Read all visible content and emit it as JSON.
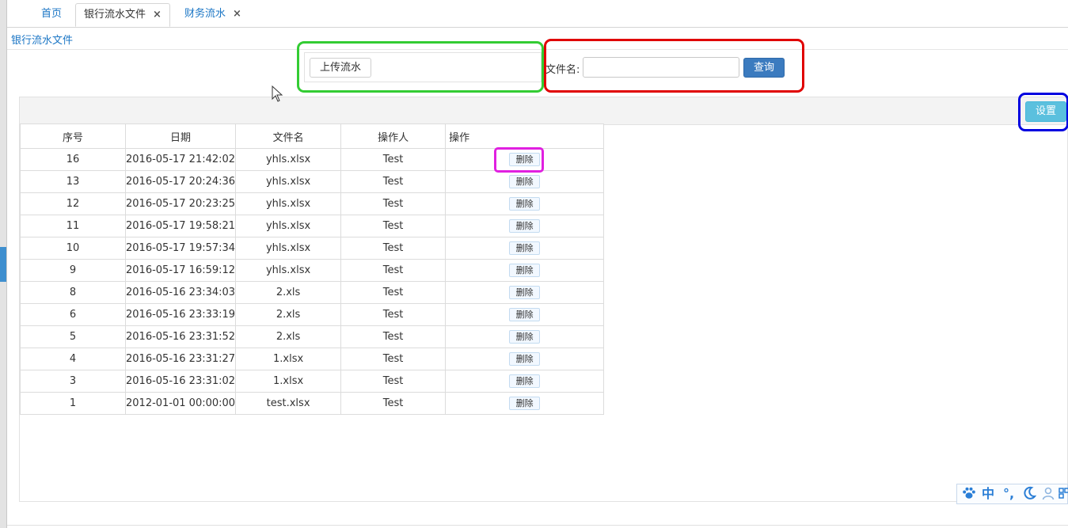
{
  "tabs": [
    {
      "label": "首页",
      "closable": false,
      "active": false
    },
    {
      "label": "银行流水文件",
      "closable": true,
      "active": true
    },
    {
      "label": "财务流水",
      "closable": true,
      "active": false
    }
  ],
  "tab_close_glyph": "×",
  "breadcrumb": "银行流水文件",
  "upload": {
    "button_label": "上传流水"
  },
  "search": {
    "label": "文件名:",
    "value": "",
    "placeholder": "",
    "query_label": "查询"
  },
  "toolbar": {
    "settings_label": "设置"
  },
  "table": {
    "columns": [
      "序号",
      "日期",
      "文件名",
      "操作人",
      "操作"
    ],
    "delete_label": "删除",
    "rows": [
      {
        "id": "16",
        "date": "2016-05-17 21:42:02",
        "file": "yhls.xlsx",
        "operator": "Test"
      },
      {
        "id": "13",
        "date": "2016-05-17 20:24:36",
        "file": "yhls.xlsx",
        "operator": "Test"
      },
      {
        "id": "12",
        "date": "2016-05-17 20:23:25",
        "file": "yhls.xlsx",
        "operator": "Test"
      },
      {
        "id": "11",
        "date": "2016-05-17 19:58:21",
        "file": "yhls.xlsx",
        "operator": "Test"
      },
      {
        "id": "10",
        "date": "2016-05-17 19:57:34",
        "file": "yhls.xlsx",
        "operator": "Test"
      },
      {
        "id": "9",
        "date": "2016-05-17 16:59:12",
        "file": "yhls.xlsx",
        "operator": "Test"
      },
      {
        "id": "8",
        "date": "2016-05-16 23:34:03",
        "file": "2.xls",
        "operator": "Test"
      },
      {
        "id": "6",
        "date": "2016-05-16 23:33:19",
        "file": "2.xls",
        "operator": "Test"
      },
      {
        "id": "5",
        "date": "2016-05-16 23:31:52",
        "file": "2.xls",
        "operator": "Test"
      },
      {
        "id": "4",
        "date": "2016-05-16 23:31:27",
        "file": "1.xlsx",
        "operator": "Test"
      },
      {
        "id": "3",
        "date": "2016-05-16 23:31:02",
        "file": "1.xlsx",
        "operator": "Test"
      },
      {
        "id": "1",
        "date": "2012-01-01 00:00:00",
        "file": "test.xlsx",
        "operator": "Test"
      }
    ]
  },
  "ime": {
    "items": [
      "paw-icon",
      "中",
      "°,",
      "moon-icon",
      "user-icon",
      "grid-icon"
    ]
  },
  "colors": {
    "link": "#1b76c5",
    "primary_button": "#3b7bbf",
    "info_button": "#5bc0de",
    "highlight_green": "#33cc33",
    "highlight_red": "#e00000",
    "highlight_blue": "#0000e0",
    "highlight_magenta": "#e020e0"
  }
}
